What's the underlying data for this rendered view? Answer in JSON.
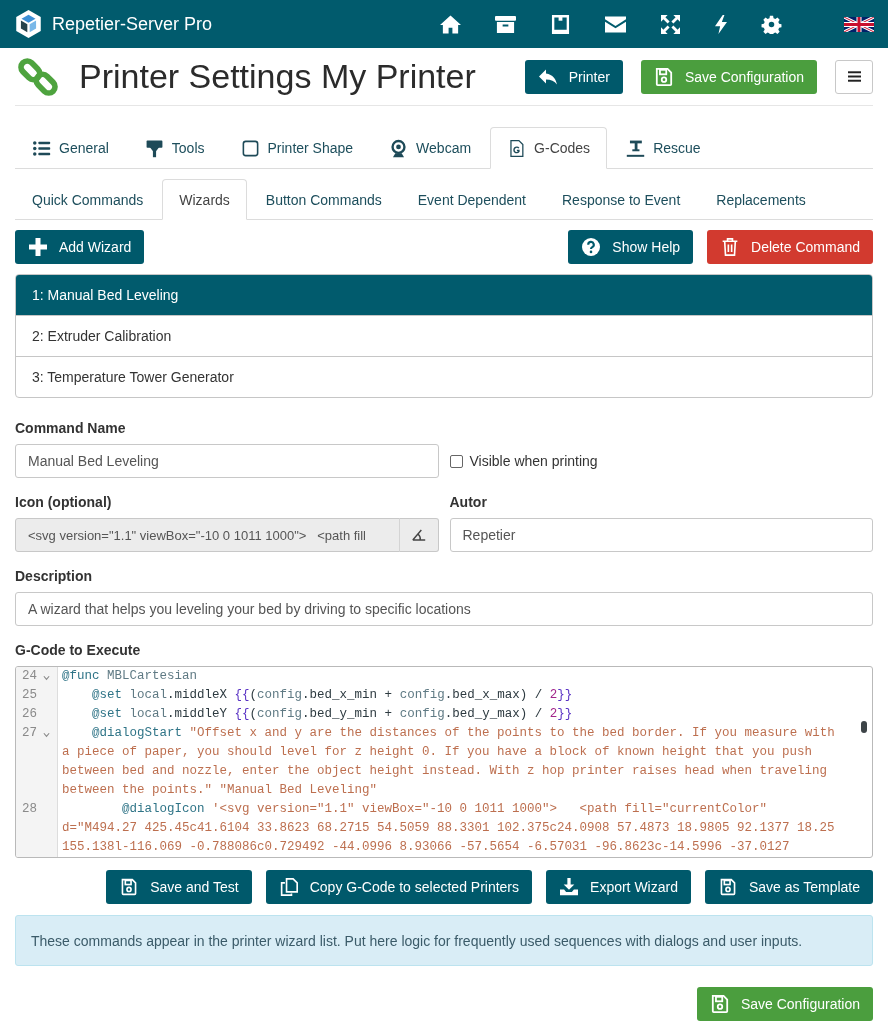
{
  "navbar": {
    "brand": "Repetier-Server Pro"
  },
  "header": {
    "title": "Printer Settings My Printer",
    "back_button": "Printer",
    "save_button": "Save Configuration"
  },
  "tabs": [
    {
      "label": "General",
      "selected": false
    },
    {
      "label": "Tools",
      "selected": false
    },
    {
      "label": "Printer Shape",
      "selected": false
    },
    {
      "label": "Webcam",
      "selected": false
    },
    {
      "label": "G-Codes",
      "selected": true
    },
    {
      "label": "Rescue",
      "selected": false
    }
  ],
  "subtabs": [
    {
      "label": "Quick Commands",
      "selected": false
    },
    {
      "label": "Wizards",
      "selected": true
    },
    {
      "label": "Button Commands",
      "selected": false
    },
    {
      "label": "Event Dependent",
      "selected": false
    },
    {
      "label": "Response to Event",
      "selected": false
    },
    {
      "label": "Replacements",
      "selected": false
    }
  ],
  "toolbar": {
    "add_button": "Add Wizard",
    "help_button": "Show Help",
    "delete_button": "Delete Command"
  },
  "wizards": [
    {
      "label": "1: Manual Bed Leveling",
      "selected": true
    },
    {
      "label": "2: Extruder Calibration",
      "selected": false
    },
    {
      "label": "3: Temperature Tower Generator",
      "selected": false
    }
  ],
  "form": {
    "command_name": {
      "label": "Command Name",
      "value": "Manual Bed Leveling"
    },
    "visible_when_printing": {
      "label": "Visible when printing",
      "checked": false
    },
    "icon": {
      "label": "Icon (optional)",
      "value": "<svg version=\"1.1\" viewBox=\"-10 0 1011 1000\">   <path fill",
      "readonly": true
    },
    "author": {
      "label": "Autor",
      "value": "Repetier"
    },
    "description": {
      "label": "Description",
      "value": "A wizard that helps you leveling your bed by driving to specific locations"
    },
    "gcode": {
      "label": "G-Code to Execute",
      "lines": [
        {
          "number": "24",
          "foldable": true,
          "tokens": [
            {
              "kind": "keyword",
              "text": "@func"
            },
            {
              "kind": "variable",
              "text": " MBLCartesian"
            }
          ]
        },
        {
          "number": "25",
          "foldable": false,
          "tokens": [
            {
              "kind": "keyword",
              "text": "    @set"
            },
            {
              "kind": "variable",
              "text": " local"
            },
            {
              "kind": "plain",
              "text": ".middleX "
            },
            {
              "kind": "brace",
              "text": "{{"
            },
            {
              "kind": "plain",
              "text": "("
            },
            {
              "kind": "variable",
              "text": "config"
            },
            {
              "kind": "plain",
              "text": ".bed_x_min + "
            },
            {
              "kind": "variable",
              "text": "config"
            },
            {
              "kind": "plain",
              "text": ".bed_x_max) / "
            },
            {
              "kind": "number",
              "text": "2"
            },
            {
              "kind": "brace",
              "text": "}}"
            }
          ]
        },
        {
          "number": "26",
          "foldable": false,
          "tokens": [
            {
              "kind": "keyword",
              "text": "    @set"
            },
            {
              "kind": "variable",
              "text": " local"
            },
            {
              "kind": "plain",
              "text": ".middleY "
            },
            {
              "kind": "brace",
              "text": "{{"
            },
            {
              "kind": "plain",
              "text": "("
            },
            {
              "kind": "variable",
              "text": "config"
            },
            {
              "kind": "plain",
              "text": ".bed_y_min + "
            },
            {
              "kind": "variable",
              "text": "config"
            },
            {
              "kind": "plain",
              "text": ".bed_y_max) / "
            },
            {
              "kind": "number",
              "text": "2"
            },
            {
              "kind": "brace",
              "text": "}}"
            }
          ]
        },
        {
          "number": "27",
          "foldable": true,
          "tokens": [
            {
              "kind": "keyword",
              "text": "    @dialogStart"
            },
            {
              "kind": "string",
              "text": " \"Offset x and y are the distances of the points to the bed border. If you measure with a piece of paper, you should level for z height 0. If you have a block of known height that you push between bed and nozzle, enter the object height instead. With z hop printer raises head when traveling between the points.\" \"Manual Bed Leveling\""
            }
          ]
        },
        {
          "number": "28",
          "foldable": false,
          "tokens": [
            {
              "kind": "keyword",
              "text": "        @dialogIcon"
            },
            {
              "kind": "string",
              "text": " '<svg version=\"1.1\" viewBox=\"-10 0 1011 1000\">   <path fill=\"currentColor\" d=\"M494.27 425.45c41.6104 33.8623 68.2715 54.5059 88.3301 102.375c24.0908 57.4873 18.9805 92.1377 18.25 155.138l-116.069 -0.788086c0.729492 -44.0996 8.93066 -57.5654 -6.57031 -96.8623c-14.5996 -37.0127"
            }
          ]
        }
      ]
    }
  },
  "actions": [
    "Save and Test",
    "Copy G-Code to selected Printers",
    "Export Wizard",
    "Save as Template"
  ],
  "info": "These commands appear in the printer wizard list. Put here logic for frequently used sequences with dialogs and user inputs.",
  "footer": {
    "save_button": "Save Configuration"
  }
}
